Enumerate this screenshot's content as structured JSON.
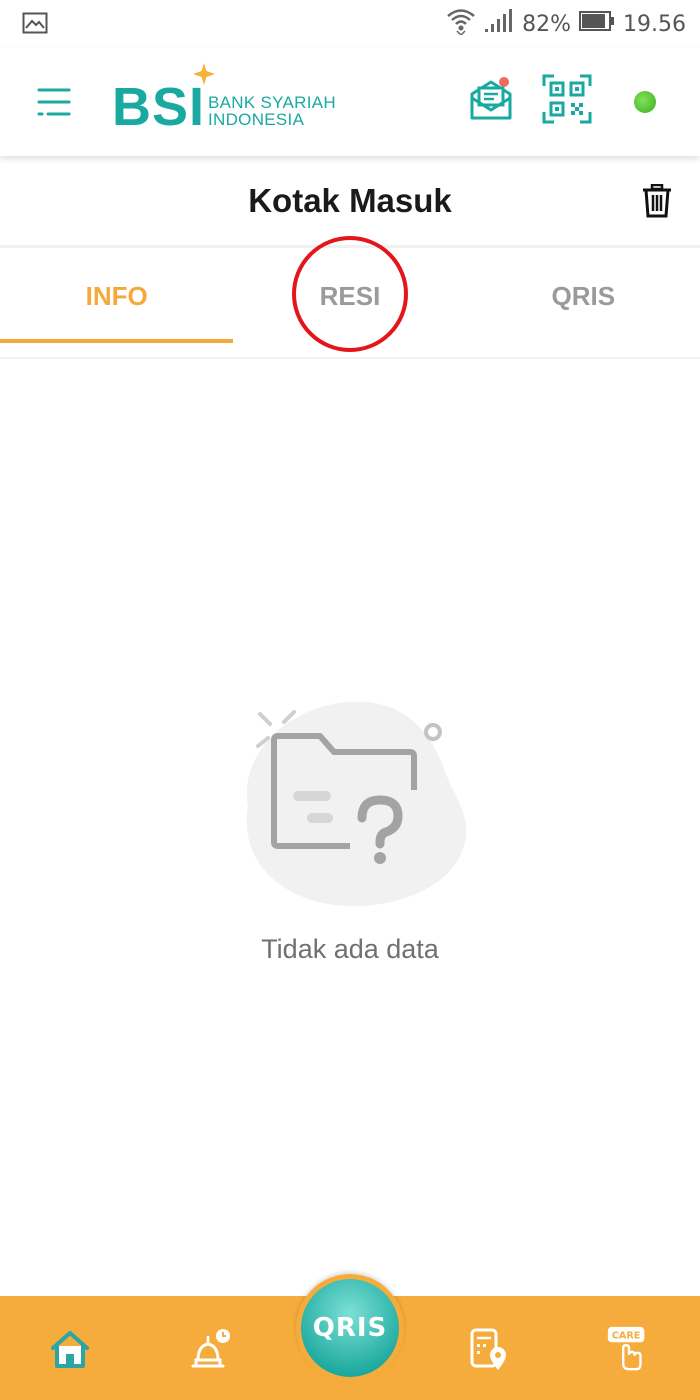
{
  "status_bar": {
    "battery_percent": "82%",
    "time": "19.56",
    "icons": [
      "gallery-icon",
      "wifi-icon",
      "signal-icon",
      "battery-icon"
    ]
  },
  "header": {
    "logo_text": "BSI",
    "logo_subtitle_line1": "BANK SYARIAH",
    "logo_subtitle_line2": "INDONESIA",
    "icons": [
      "menu-icon",
      "mail-icon",
      "qr-code-icon"
    ],
    "online_status_color": "#3cae22",
    "brand_color": "#1aa9a0"
  },
  "page": {
    "title": "Kotak Masuk",
    "delete_icon": "trash-icon"
  },
  "tabs": [
    {
      "label": "INFO",
      "active": true
    },
    {
      "label": "RESI",
      "active": false
    },
    {
      "label": "QRIS",
      "active": false
    }
  ],
  "accent_color": "#f5a93a",
  "empty_state": {
    "message": "Tidak ada data",
    "icon": "empty-folder-question-icon"
  },
  "bottom_nav": {
    "items": [
      "home-icon",
      "mosque-prayer-time-icon",
      "qris-button",
      "atm-location-icon",
      "care-icon"
    ],
    "qris_label": "QRIS",
    "care_label": "CARE",
    "background_color": "#f6ac3c"
  }
}
